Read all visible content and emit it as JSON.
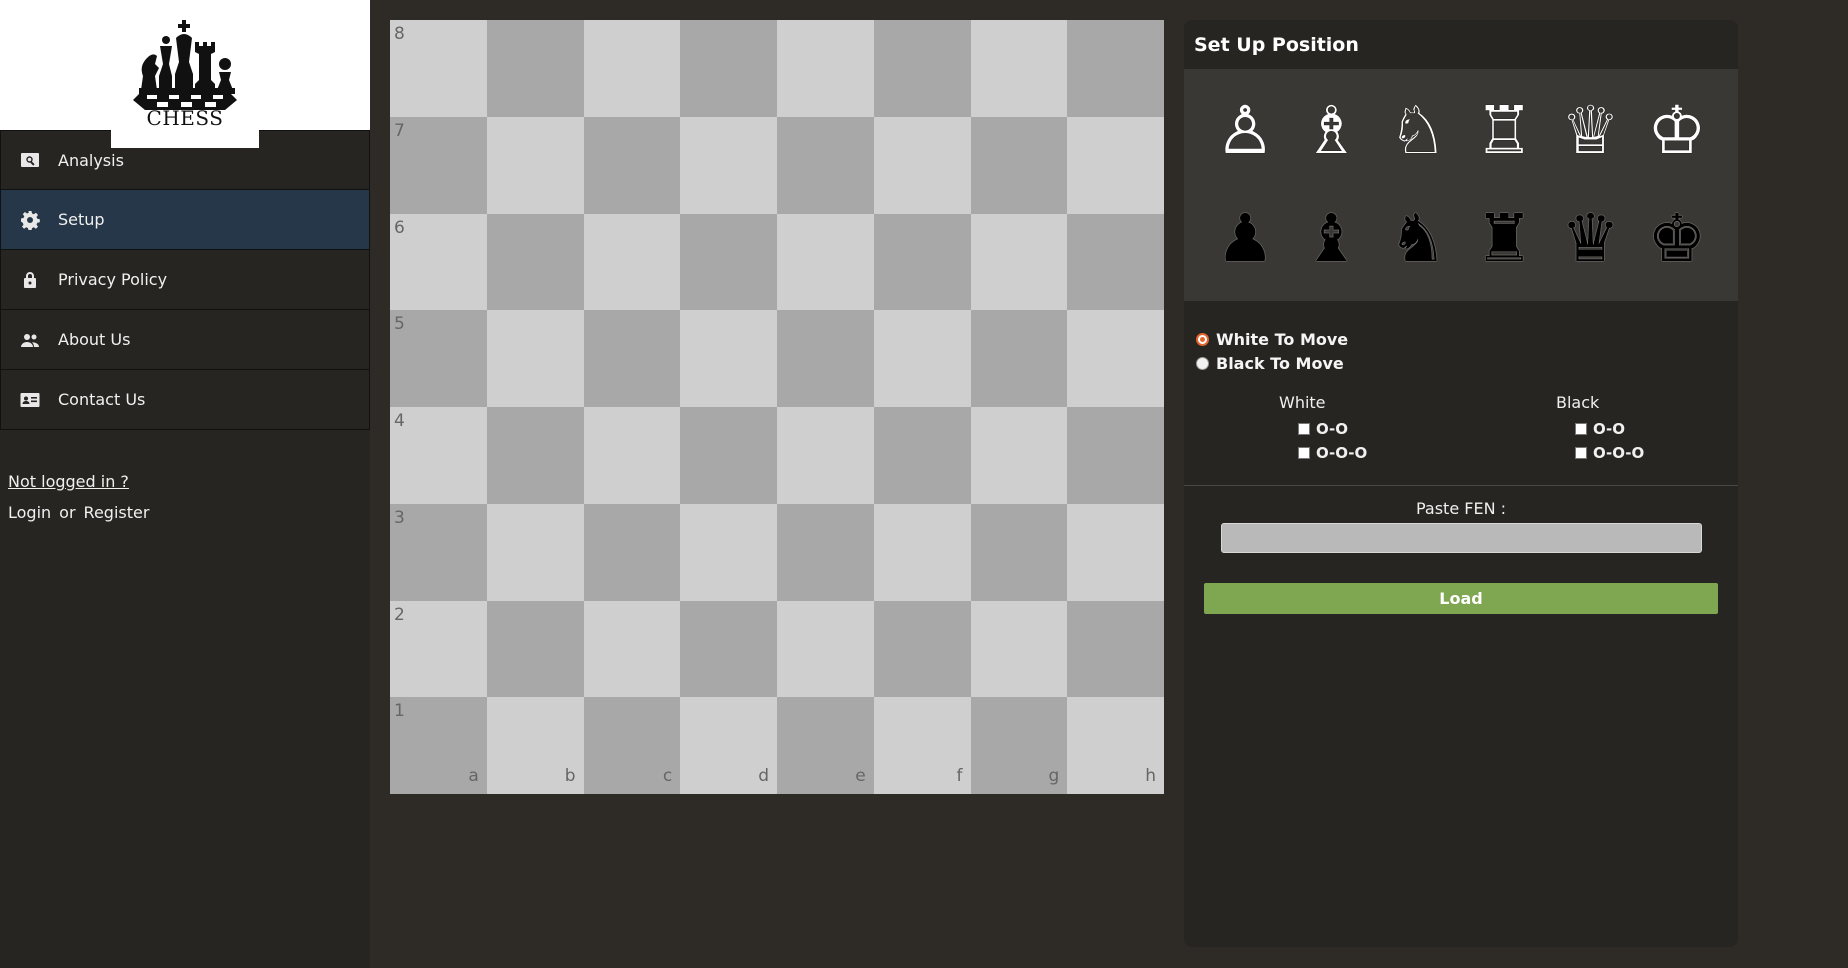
{
  "logo": {
    "text": "CHESS"
  },
  "sidebar": {
    "items": [
      {
        "label": "Analysis",
        "icon": "search-icon",
        "active": false
      },
      {
        "label": "Setup",
        "icon": "gear-icon",
        "active": true
      },
      {
        "label": "Privacy Policy",
        "icon": "lock-icon",
        "active": false
      },
      {
        "label": "About Us",
        "icon": "people-icon",
        "active": false
      },
      {
        "label": "Contact Us",
        "icon": "contact-card-icon",
        "active": false
      }
    ],
    "auth": {
      "not_logged": "Not logged in ?",
      "login": "Login",
      "or": "or",
      "register": "Register"
    }
  },
  "board": {
    "ranks": [
      "8",
      "7",
      "6",
      "5",
      "4",
      "3",
      "2",
      "1"
    ],
    "files": [
      "a",
      "b",
      "c",
      "d",
      "e",
      "f",
      "g",
      "h"
    ],
    "light_color": "#cfcfcf",
    "dark_color": "#a8a8a8"
  },
  "panel": {
    "title": "Set Up Position",
    "white_pieces": [
      {
        "name": "white-pawn",
        "glyph": "♙"
      },
      {
        "name": "white-bishop",
        "glyph": "♗"
      },
      {
        "name": "white-knight",
        "glyph": "♘"
      },
      {
        "name": "white-rook",
        "glyph": "♖"
      },
      {
        "name": "white-queen",
        "glyph": "♕"
      },
      {
        "name": "white-king",
        "glyph": "♔"
      }
    ],
    "black_pieces": [
      {
        "name": "black-pawn",
        "glyph": "♟"
      },
      {
        "name": "black-bishop",
        "glyph": "♝"
      },
      {
        "name": "black-knight",
        "glyph": "♞"
      },
      {
        "name": "black-rook",
        "glyph": "♜"
      },
      {
        "name": "black-queen",
        "glyph": "♛"
      },
      {
        "name": "black-king",
        "glyph": "♚"
      }
    ],
    "to_move": {
      "white": "White To Move",
      "black": "Black To Move",
      "selected": "white"
    },
    "castling": {
      "white_label": "White",
      "black_label": "Black",
      "short": "O-O",
      "long": "O-O-O"
    },
    "fen": {
      "label": "Paste FEN :",
      "value": "",
      "placeholder": ""
    },
    "load_label": "Load",
    "load_color": "#7fa650",
    "radio_accent": "#e4642c"
  }
}
